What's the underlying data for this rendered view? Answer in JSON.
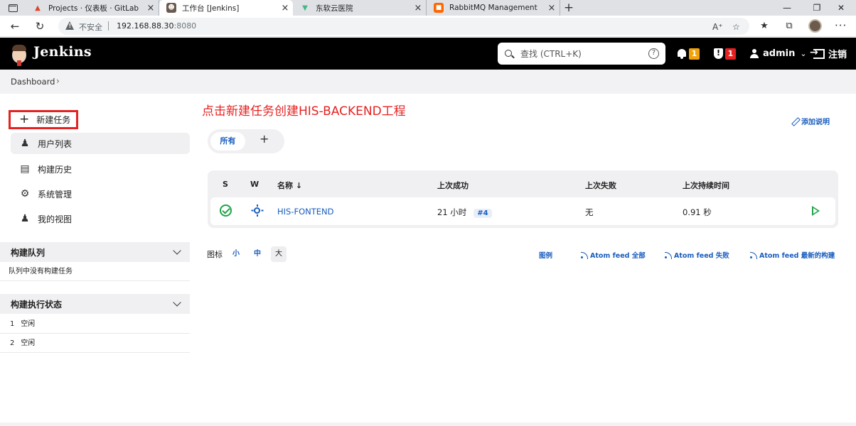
{
  "browser": {
    "tabs": [
      {
        "title": "Projects · 仪表板 · GitLab",
        "icon_name": "gitlab-icon",
        "color": "#e24329"
      },
      {
        "title": "工作台 [Jenkins]",
        "icon_name": "jenkins-icon",
        "color": "#6b5b4e"
      },
      {
        "title": "东软云医院",
        "icon_name": "vue-icon",
        "color": "#42b883"
      },
      {
        "title": "RabbitMQ Management",
        "icon_name": "rabbitmq-icon",
        "color": "#ff6600"
      }
    ],
    "address": {
      "security_label": "不安全",
      "host": "192.168.88.30",
      "port": ":8080"
    }
  },
  "header": {
    "brand": "Jenkins",
    "search": {
      "placeholder": "查找 (CTRL+K)"
    },
    "notifications_count": "1",
    "notifications_color": "#f0a30a",
    "security_count": "1",
    "security_color": "#e52222",
    "user": "admin",
    "logout": "注销"
  },
  "breadcrumb": {
    "items": [
      "Dashboard"
    ]
  },
  "sidebar": {
    "items": [
      {
        "label": "新建任务",
        "icon": "plus-icon"
      },
      {
        "label": "用户列表",
        "icon": "people-icon"
      },
      {
        "label": "构建历史",
        "icon": "history-icon"
      },
      {
        "label": "系统管理",
        "icon": "gear-icon"
      },
      {
        "label": "我的视图",
        "icon": "people-icon"
      }
    ],
    "queue": {
      "title": "构建队列",
      "empty_text": "队列中没有构建任务"
    },
    "executors": {
      "title": "构建执行状态",
      "rows": [
        {
          "num": "1",
          "status": "空闲"
        },
        {
          "num": "2",
          "status": "空闲"
        }
      ]
    }
  },
  "main": {
    "annotation": "点击新建任务创建HIS-BACKEND工程",
    "add_description": "添加说明",
    "views": {
      "active": "所有",
      "add": "+"
    },
    "table": {
      "headers": [
        "S",
        "W",
        "名称 ↓",
        "上次成功",
        "上次失败",
        "上次持续时间"
      ],
      "rows": [
        {
          "name": "HIS-FONTEND",
          "last_success": "21 小时",
          "last_success_build": "#4",
          "last_failure": "无",
          "last_duration": "0.91 秒",
          "status": "success",
          "weather": "sunny"
        }
      ]
    },
    "footer": {
      "icon_label": "图标",
      "sizes": [
        "小",
        "中",
        "大"
      ],
      "selected_size": "大",
      "legend": "图例",
      "feeds": [
        "Atom feed 全部",
        "Atom feed 失败",
        "Atom feed 最新的构建"
      ]
    }
  }
}
